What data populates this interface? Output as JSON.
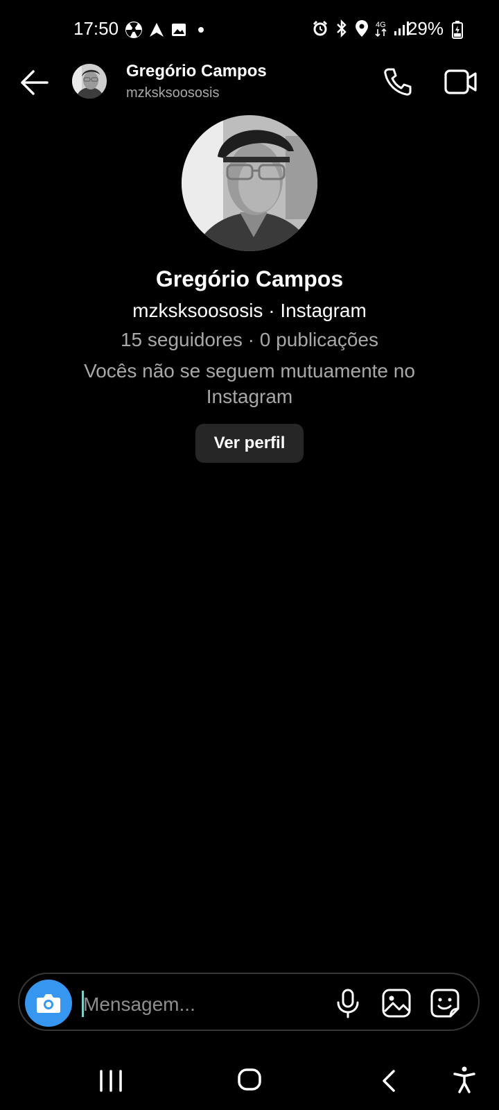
{
  "status_bar": {
    "time": "17:50",
    "battery": "29%",
    "left_icons": [
      "nuclear-icon",
      "nav-arrow-icon",
      "image-icon",
      "dot-icon"
    ],
    "right_icons": [
      "alarm-icon",
      "bluetooth-icon",
      "location-icon",
      "4g-icon",
      "signal-icon",
      "battery-icon"
    ]
  },
  "header": {
    "name": "Gregório Campos",
    "username": "mzksksoososis"
  },
  "profile": {
    "name": "Gregório Campos",
    "username_line": "mzksksoososis · Instagram",
    "stats": "15 seguidores · 0 publicações",
    "mutual_note": "Vocês não se seguem mutuamente no Instagram",
    "view_profile_label": "Ver perfil"
  },
  "composer": {
    "placeholder": "Mensagem..."
  },
  "colors": {
    "background": "#000000",
    "camera_button": "#3797f0",
    "secondary_text": "#a8a8a8",
    "button_bg": "#262626"
  }
}
